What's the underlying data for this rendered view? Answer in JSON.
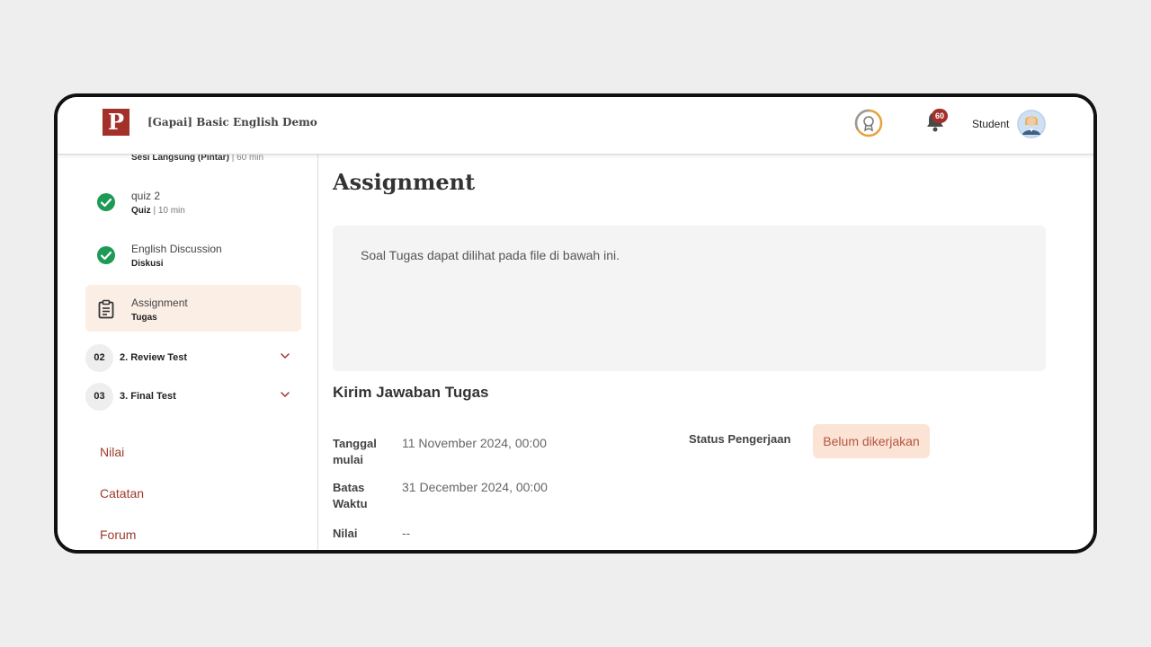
{
  "header": {
    "logo_letter": "P",
    "course_title": "[Gapai] Basic English Demo",
    "notification_count": "60",
    "user_name": "Student"
  },
  "sidebar": {
    "prev_item": {
      "type": "Sesi Langsung (Pintar)",
      "duration": "| 60 min"
    },
    "items": [
      {
        "title": "quiz 2",
        "type": "Quiz",
        "duration": "| 10 min",
        "status_icon": "check-circle-icon",
        "active": false
      },
      {
        "title": "English Discussion",
        "type": "Diskusi",
        "duration": "",
        "status_icon": "check-circle-icon",
        "active": false
      },
      {
        "title": "Assignment",
        "type": "Tugas",
        "duration": "",
        "status_icon": "clipboard-icon",
        "active": true
      }
    ],
    "sections": [
      {
        "number": "02",
        "title": "2. Review Test"
      },
      {
        "number": "03",
        "title": "3. Final Test"
      }
    ],
    "links": [
      "Nilai",
      "Catatan",
      "Forum"
    ]
  },
  "main": {
    "page_title": "Assignment",
    "instructions": "Soal Tugas dapat dilihat pada file di bawah ini.",
    "submit_heading": "Kirim Jawaban Tugas",
    "fields": {
      "start_label": "Tanggal mulai",
      "start_value": "11 November 2024, 00:00",
      "deadline_label": "Batas Waktu",
      "deadline_value": "31 December 2024, 00:00",
      "score_label": "Nilai",
      "score_value": "--",
      "status_label": "Status Pengerjaan",
      "status_value": "Belum dikerjakan"
    }
  },
  "colors": {
    "brand": "#a3312a",
    "success": "#1e9a57",
    "active_bg": "#fbeee5",
    "status_bg": "#fbe3d6",
    "link": "#9d3a2c"
  }
}
